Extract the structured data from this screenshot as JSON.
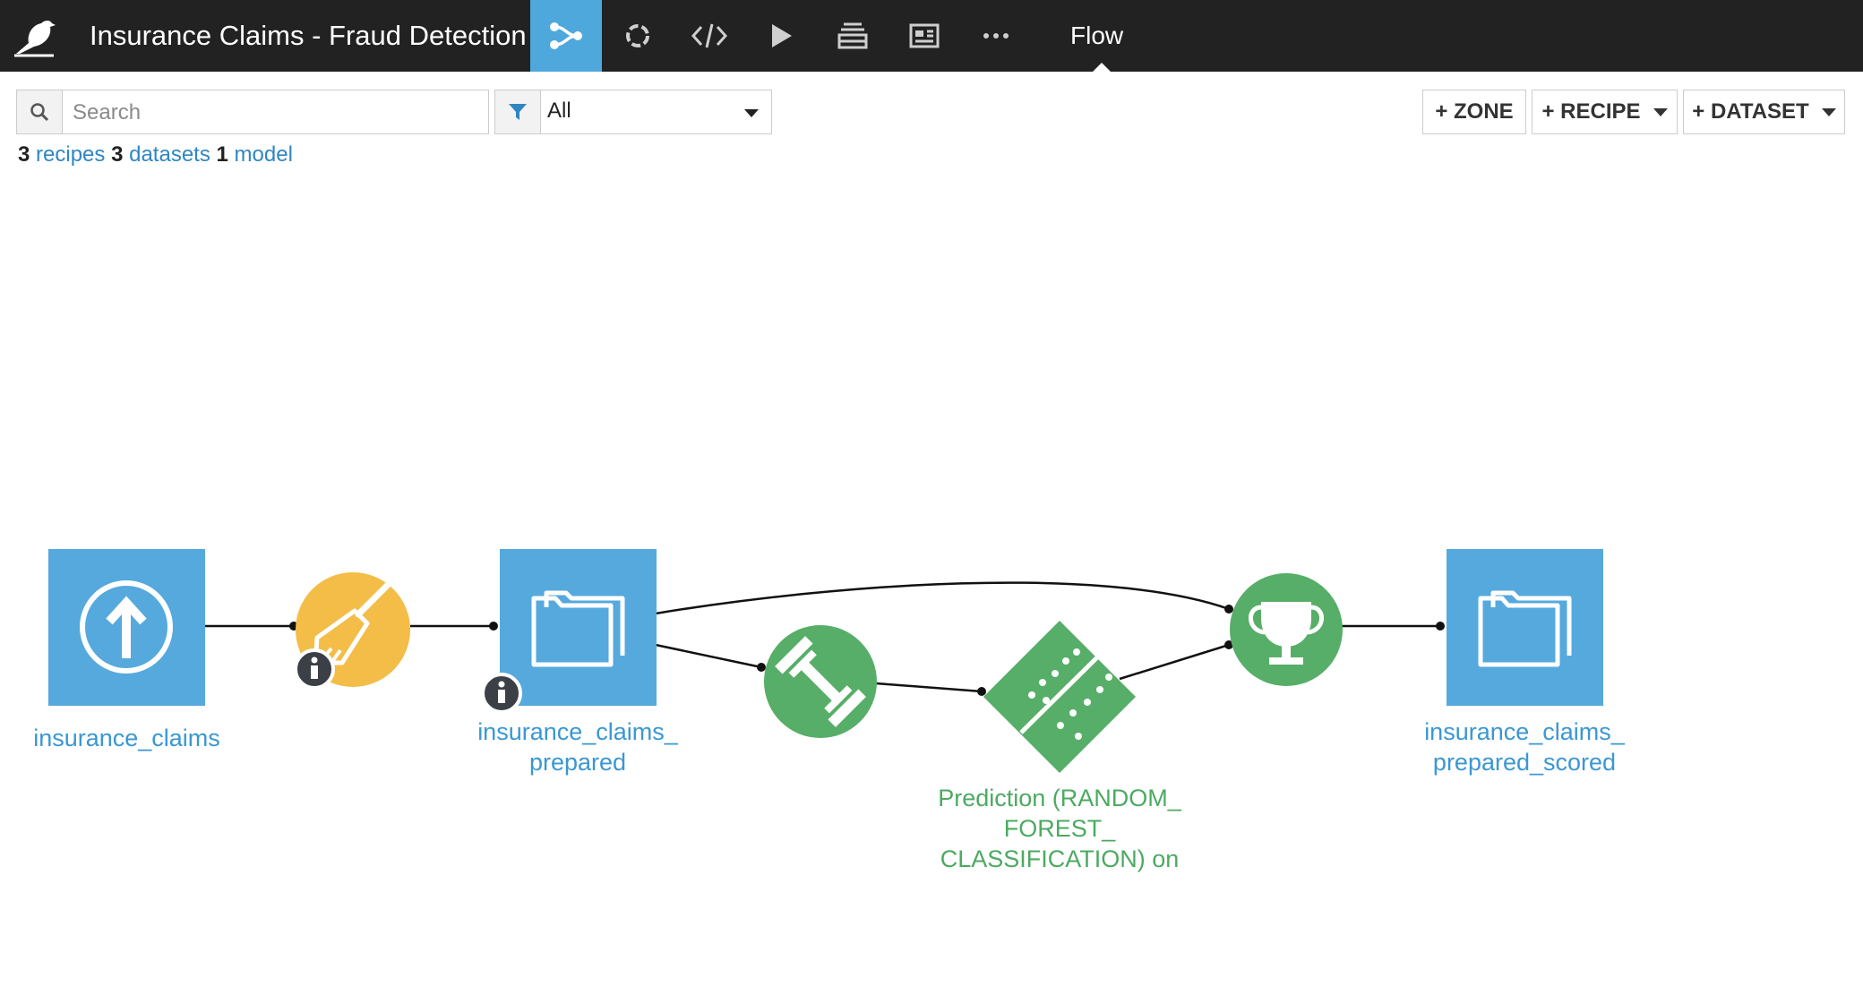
{
  "header": {
    "project_title": "Insurance Claims - Fraud Detection",
    "current_view": "Flow",
    "nav_icons": [
      "flow-icon",
      "jobs-icon",
      "code-icon",
      "run-icon",
      "datasets-icon",
      "dashboard-icon",
      "more-icon"
    ]
  },
  "toolbar": {
    "search_placeholder": "Search",
    "filter_value": "All",
    "zone_label": "+ ZONE",
    "recipe_label": "+ RECIPE",
    "dataset_label": "+ DATASET"
  },
  "summary": {
    "recipes_count": "3",
    "recipes_label": "recipes",
    "datasets_count": "3",
    "datasets_label": "datasets",
    "model_count": "1",
    "model_label": "model"
  },
  "flow": {
    "dataset_input": "insurance_claims",
    "dataset_prepared_line1": "insurance_claims_",
    "dataset_prepared_line2": "prepared",
    "model_line1": "Prediction (RANDOM_",
    "model_line2": "FOREST_",
    "model_line3": "CLASSIFICATION) on",
    "dataset_scored_line1": "insurance_claims_",
    "dataset_scored_line2": "prepared_scored"
  },
  "colors": {
    "topbar": "#222222",
    "accent_blue": "#4ea8dc",
    "dataset_blue": "#55a9dd",
    "prepare_yellow": "#f3bd48",
    "ml_green": "#57ae68",
    "link_blue": "#2f86c3"
  }
}
